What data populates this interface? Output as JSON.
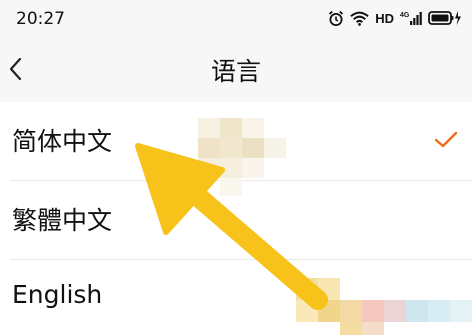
{
  "status_bar": {
    "time": "20:27",
    "network": "HD",
    "icons": [
      "alarm-icon",
      "wifi-icon",
      "4g-signal-icon",
      "battery-charging-icon"
    ]
  },
  "nav": {
    "back_icon": "chevron-left-icon",
    "title": "语言"
  },
  "languages": [
    {
      "label": "简体中文",
      "selected": true
    },
    {
      "label": "繁體中文",
      "selected": false
    },
    {
      "label": "English",
      "selected": false
    }
  ],
  "colors": {
    "accent": "#f06a1c",
    "annotation_arrow": "#f7c21a",
    "background": "#f3f3f3"
  }
}
